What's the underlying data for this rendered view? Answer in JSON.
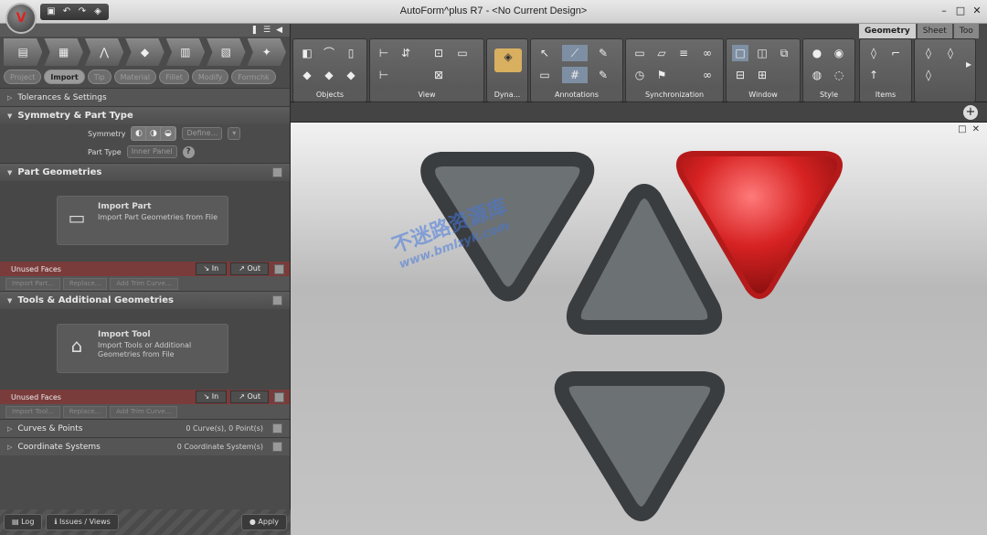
{
  "window": {
    "title": "AutoForm^plus R7 - <No Current Design>"
  },
  "left_panel": {
    "subtabs": [
      "Project",
      "Import",
      "Tip",
      "Material",
      "Fillet",
      "Modify",
      "Formchk"
    ],
    "active_subtab": "Import",
    "tolerances": "Tolerances & Settings",
    "symmetry": {
      "header": "Symmetry & Part Type",
      "sym_label": "Symmetry",
      "define": "Define...",
      "part_type_label": "Part Type",
      "part_type_value": "Inner Panel"
    },
    "part_geometries": {
      "header": "Part Geometries",
      "box_title": "Import Part",
      "box_desc": "Import Part Geometries from File",
      "unused": "Unused Faces",
      "in": "In",
      "out": "Out",
      "tools": [
        "Import Part...",
        "Replace...",
        "Add Trim Curve..."
      ]
    },
    "tools_geometries": {
      "header": "Tools & Additional Geometries",
      "box_title": "Import Tool",
      "box_desc": "Import Tools or Additional Geometries from File",
      "unused": "Unused Faces",
      "in": "In",
      "out": "Out",
      "tools": [
        "Import Tool...",
        "Replace...",
        "Add Trim Curve..."
      ]
    },
    "curves": {
      "label": "Curves & Points",
      "count": "0 Curve(s), 0 Point(s)"
    },
    "coords": {
      "label": "Coordinate Systems",
      "count": "0 Coordinate System(s)"
    },
    "bottom": {
      "log": "Log",
      "issues": "Issues / Views",
      "apply": "Apply"
    }
  },
  "ribbon": {
    "tabs": [
      "Geometry",
      "Sheet",
      "Too"
    ],
    "active_tab": "Geometry",
    "groups": [
      "Objects",
      "View",
      "Dyna...",
      "Annotations",
      "Synchronization",
      "Window",
      "Style",
      "Items"
    ]
  },
  "watermark": {
    "main": "不迷路资源库",
    "url": "www.bmlzyk.com"
  }
}
